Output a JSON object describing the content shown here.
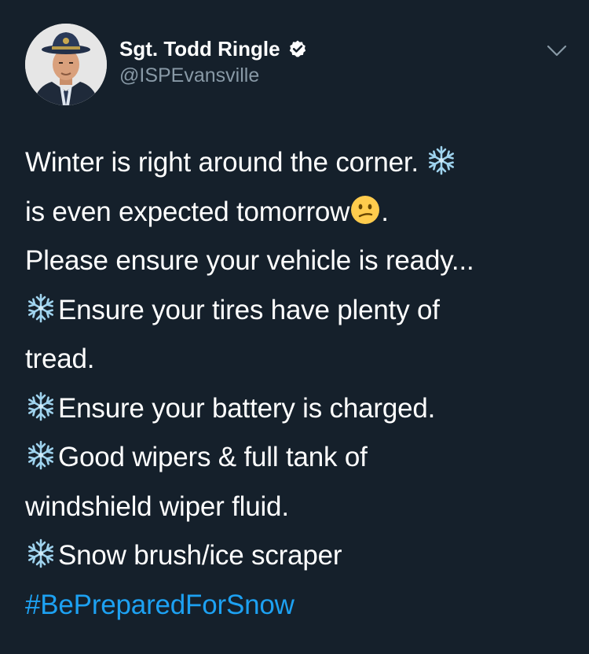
{
  "author": {
    "name": "Sgt. Todd Ringle",
    "handle": "@ISPEvansville",
    "verified_icon": "verified-badge-icon",
    "avatar": "officer-portrait"
  },
  "tweet": {
    "line1": "Winter is right around the corner.",
    "line2": "is even expected tomorrow",
    "line2_end": ".",
    "line3": "Please ensure your vehicle is ready...",
    "line4": "Ensure your tires have plenty of",
    "line5": "tread.",
    "line6": "Ensure your battery is charged.",
    "line7": "Good wipers & full tank of",
    "line8": "windshield wiper fluid.",
    "line9": "Snow brush/ice scraper",
    "hashtag": "#BePreparedForSnow"
  },
  "icons": {
    "bullet": "snowflake-icon",
    "emoji": "confused-face-icon",
    "menu": "chevron-down-icon"
  },
  "colors": {
    "background": "#15202b",
    "text": "#ffffff",
    "secondary": "#8899a6",
    "link": "#1da1f2",
    "snowflake": "#8ecbe9"
  }
}
